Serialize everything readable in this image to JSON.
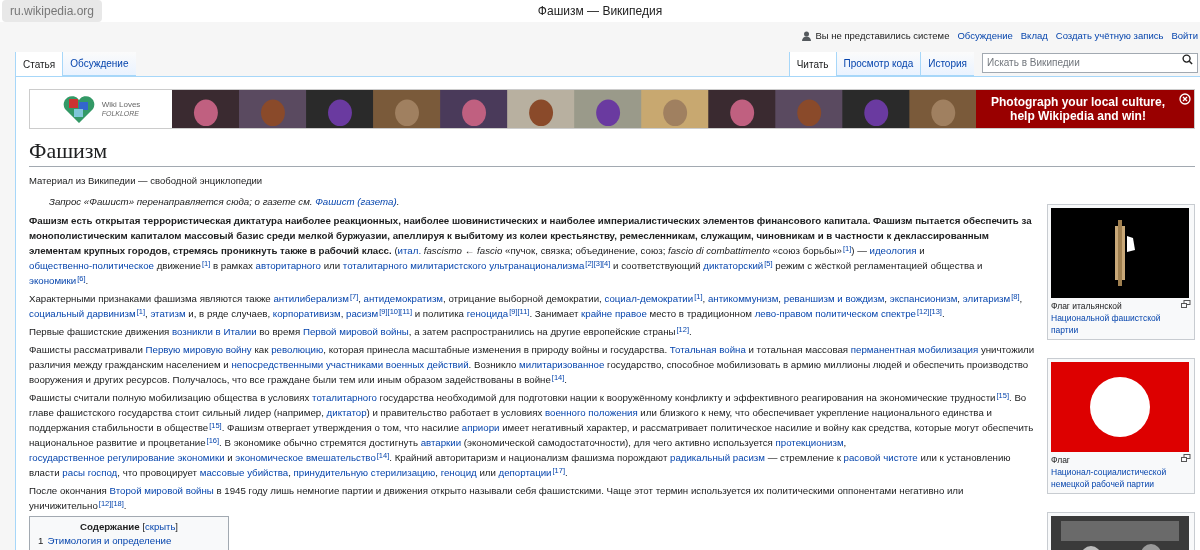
{
  "browser": {
    "address": "ru.wikipedia.org",
    "title": "Фашизм — Википедия"
  },
  "personal_tools": {
    "status": "Вы не представились системе",
    "links": [
      "Обсуждение",
      "Вклад",
      "Создать учётную запись",
      "Войти"
    ]
  },
  "left_tabs": [
    {
      "label": "Статья",
      "selected": true
    },
    {
      "label": "Обсуждение",
      "selected": false
    }
  ],
  "right_tabs": [
    {
      "label": "Читать",
      "selected": true
    },
    {
      "label": "Просмотр кода",
      "selected": false
    },
    {
      "label": "История",
      "selected": false
    }
  ],
  "search": {
    "placeholder": "Искать в Википедии"
  },
  "banner": {
    "logo_top": "Wiki Loves",
    "logo_bottom": "FOLKLORE",
    "message": "Photograph your local culture, help Wikipedia and win!"
  },
  "heading": "Фашизм",
  "tagline": "Материал из Википедии — свободной энциклопедии",
  "hatnote": [
    {
      "kind": "text",
      "text": "Запрос «Фашист» перенаправляется сюда; о газете см. "
    },
    {
      "kind": "link",
      "text": "Фашист (газета)"
    },
    {
      "kind": "text",
      "text": "."
    }
  ],
  "paragraphs": [
    [
      {
        "kind": "bold",
        "text": "Фашизм есть открытая террористическая диктатура наиболее реакционных, наиболее шовинистических и наиболее империалистических элементов финансового капитала. Фашизм пытается обеспечить за монополистическим капиталом массовый базис среди мелкой буржуазии, апеллируя к выбитому из колеи крестьянству, ремесленникам, служащим, чиновникам и в частности к деклассированным элементам крупных городов, стремясь проникнуть также в рабочий класс."
      },
      {
        "kind": "text",
        "text": " ("
      },
      {
        "kind": "link",
        "text": "итал."
      },
      {
        "kind": "italic",
        "text": " fascismo"
      },
      {
        "kind": "text",
        "text": " ← "
      },
      {
        "kind": "italic",
        "text": "fascio"
      },
      {
        "kind": "text",
        "text": " «пучок, связка; объединение, союз; "
      },
      {
        "kind": "italic",
        "text": "fascio di combattimento"
      },
      {
        "kind": "text",
        "text": " «союз борьбы»"
      },
      {
        "kind": "ref",
        "text": "[1]"
      },
      {
        "kind": "text",
        "text": ") — "
      },
      {
        "kind": "link",
        "text": "идеология"
      },
      {
        "kind": "text",
        "text": " и "
      },
      {
        "kind": "link",
        "text": "общественно-политическое"
      },
      {
        "kind": "text",
        "text": " движение"
      },
      {
        "kind": "ref",
        "text": "[1]"
      },
      {
        "kind": "text",
        "text": " в рамках "
      },
      {
        "kind": "link",
        "text": "авторитарного"
      },
      {
        "kind": "text",
        "text": " или "
      },
      {
        "kind": "link",
        "text": "тоталитарного милитаристского ультранационализма"
      },
      {
        "kind": "ref",
        "text": "[2][3][4]"
      },
      {
        "kind": "text",
        "text": " и соответствующий "
      },
      {
        "kind": "link",
        "text": "диктаторский"
      },
      {
        "kind": "ref",
        "text": "[5]"
      },
      {
        "kind": "text",
        "text": " режим с жёсткой регламентацией общества и "
      },
      {
        "kind": "link",
        "text": "экономики"
      },
      {
        "kind": "ref",
        "text": "[6]"
      },
      {
        "kind": "text",
        "text": "."
      }
    ],
    [
      {
        "kind": "text",
        "text": "Характерными признаками фашизма являются также "
      },
      {
        "kind": "link",
        "text": "антилиберализм"
      },
      {
        "kind": "ref",
        "text": "[7]"
      },
      {
        "kind": "text",
        "text": ", "
      },
      {
        "kind": "link",
        "text": "антидемократизм"
      },
      {
        "kind": "text",
        "text": ", отрицание выборной демократии, "
      },
      {
        "kind": "link",
        "text": "социал-демократии"
      },
      {
        "kind": "ref",
        "text": "[1]"
      },
      {
        "kind": "text",
        "text": ", "
      },
      {
        "kind": "link",
        "text": "антикоммунизм"
      },
      {
        "kind": "text",
        "text": ", "
      },
      {
        "kind": "link",
        "text": "реваншизм и вождизм"
      },
      {
        "kind": "text",
        "text": ", "
      },
      {
        "kind": "link",
        "text": "экспансионизм"
      },
      {
        "kind": "text",
        "text": ", "
      },
      {
        "kind": "link",
        "text": "элитаризм"
      },
      {
        "kind": "ref",
        "text": "[8]"
      },
      {
        "kind": "text",
        "text": ", "
      },
      {
        "kind": "link",
        "text": "социальный дарвинизм"
      },
      {
        "kind": "ref",
        "text": "[1]"
      },
      {
        "kind": "text",
        "text": ", "
      },
      {
        "kind": "link",
        "text": "этатизм"
      },
      {
        "kind": "text",
        "text": " и, в ряде случаев, "
      },
      {
        "kind": "link",
        "text": "корпоративизм"
      },
      {
        "kind": "text",
        "text": ", "
      },
      {
        "kind": "link",
        "text": "расизм"
      },
      {
        "kind": "ref",
        "text": "[9][10][11]"
      },
      {
        "kind": "text",
        "text": " и политика "
      },
      {
        "kind": "link",
        "text": "геноцида"
      },
      {
        "kind": "ref",
        "text": "[9][11]"
      },
      {
        "kind": "text",
        "text": ". Занимает "
      },
      {
        "kind": "link",
        "text": "крайне правое"
      },
      {
        "kind": "text",
        "text": " место в традиционном "
      },
      {
        "kind": "link",
        "text": "лево-правом политическом спектре"
      },
      {
        "kind": "ref",
        "text": "[12][13]"
      },
      {
        "kind": "text",
        "text": "."
      }
    ],
    [
      {
        "kind": "text",
        "text": "Первые фашистские движения "
      },
      {
        "kind": "link",
        "text": "возникли в Италии"
      },
      {
        "kind": "text",
        "text": " во время "
      },
      {
        "kind": "link",
        "text": "Первой мировой войны"
      },
      {
        "kind": "text",
        "text": ", а затем распространились на другие европейские страны"
      },
      {
        "kind": "ref",
        "text": "[12]"
      },
      {
        "kind": "text",
        "text": "."
      }
    ],
    [
      {
        "kind": "text",
        "text": "Фашисты рассматривали "
      },
      {
        "kind": "link",
        "text": "Первую мировую войну"
      },
      {
        "kind": "text",
        "text": " как "
      },
      {
        "kind": "link",
        "text": "революцию"
      },
      {
        "kind": "text",
        "text": ", которая принесла масштабные изменения в природу войны и государства. "
      },
      {
        "kind": "link",
        "text": "Тотальная война"
      },
      {
        "kind": "text",
        "text": " и тотальная массовая "
      },
      {
        "kind": "link",
        "text": "перманентная мобилизация"
      },
      {
        "kind": "text",
        "text": " уничтожили различия между гражданским населением и "
      },
      {
        "kind": "link",
        "text": "непосредственными участниками военных действий"
      },
      {
        "kind": "text",
        "text": ". Возникло "
      },
      {
        "kind": "link",
        "text": "милитаризованное"
      },
      {
        "kind": "text",
        "text": " государство, способное мобилизовать в армию миллионы людей и обеспечить производство вооружения и других ресурсов. Получалось, что все граждане были тем или иным образом задействованы в войне"
      },
      {
        "kind": "ref",
        "text": "[14]"
      },
      {
        "kind": "text",
        "text": "."
      }
    ],
    [
      {
        "kind": "text",
        "text": "Фашисты считали полную мобилизацию общества в условиях "
      },
      {
        "kind": "link",
        "text": "тоталитарного"
      },
      {
        "kind": "text",
        "text": " государства необходимой для подготовки нации к вооружённому конфликту и эффективного реагирования на экономические трудности"
      },
      {
        "kind": "ref",
        "text": "[15]"
      },
      {
        "kind": "text",
        "text": ". Во главе фашистского государства стоит сильный лидер (например, "
      },
      {
        "kind": "link",
        "text": "диктатор"
      },
      {
        "kind": "text",
        "text": ") и правительство работает в условиях "
      },
      {
        "kind": "link",
        "text": "военного положения"
      },
      {
        "kind": "text",
        "text": " или близкого к нему, что обеспечивает укрепление национального единства и поддержания стабильности в обществе"
      },
      {
        "kind": "ref",
        "text": "[15]"
      },
      {
        "kind": "text",
        "text": ". Фашизм отвергает утверждения о том, что насилие "
      },
      {
        "kind": "link",
        "text": "априори"
      },
      {
        "kind": "text",
        "text": " имеет негативный характер, и рассматривает политическое насилие и войну как средства, которые могут обеспечить национальное развитие и процветание"
      },
      {
        "kind": "ref",
        "text": "[16]"
      },
      {
        "kind": "text",
        "text": ". В экономике обычно стремятся достигнуть "
      },
      {
        "kind": "link",
        "text": "автаркии"
      },
      {
        "kind": "text",
        "text": " (экономической самодостаточности), для чего активно используется "
      },
      {
        "kind": "link",
        "text": "протекционизм"
      },
      {
        "kind": "text",
        "text": ", "
      },
      {
        "kind": "link",
        "text": "государственное регулирование экономики"
      },
      {
        "kind": "text",
        "text": " и "
      },
      {
        "kind": "link",
        "text": "экономическое вмешательство"
      },
      {
        "kind": "ref",
        "text": "[14]"
      },
      {
        "kind": "text",
        "text": ". Крайний авторитаризм и национализм фашизма порождают "
      },
      {
        "kind": "link",
        "text": "радикальный расизм"
      },
      {
        "kind": "text",
        "text": " — стремление к "
      },
      {
        "kind": "link",
        "text": "расовой чистоте"
      },
      {
        "kind": "text",
        "text": " или к установлению власти "
      },
      {
        "kind": "link",
        "text": "расы господ"
      },
      {
        "kind": "text",
        "text": ", что провоцирует "
      },
      {
        "kind": "link",
        "text": "массовые убийства"
      },
      {
        "kind": "text",
        "text": ", "
      },
      {
        "kind": "link",
        "text": "принудительную стерилизацию"
      },
      {
        "kind": "text",
        "text": ", "
      },
      {
        "kind": "link",
        "text": "геноцид"
      },
      {
        "kind": "text",
        "text": " или "
      },
      {
        "kind": "link",
        "text": "депортации"
      },
      {
        "kind": "ref",
        "text": "[17]"
      },
      {
        "kind": "text",
        "text": "."
      }
    ],
    [
      {
        "kind": "text",
        "text": "После окончания "
      },
      {
        "kind": "link",
        "text": "Второй мировой войны"
      },
      {
        "kind": "text",
        "text": " в 1945 году лишь немногие партии и движения открыто называли себя фашистскими. Чаще этот термин используется их политическими оппонентами негативно или уничижительно"
      },
      {
        "kind": "ref",
        "text": "[12][18]"
      },
      {
        "kind": "text",
        "text": "."
      }
    ]
  ],
  "toc": {
    "title": "Содержание",
    "toggle_open": "[",
    "toggle": "скрыть",
    "toggle_close": "]",
    "items": [
      {
        "number": "1",
        "label": "Этимология и определение"
      }
    ]
  },
  "thumbs": [
    {
      "kind": "picture",
      "caption": [
        {
          "kind": "text",
          "text": "Флаг итальянской "
        },
        {
          "kind": "link",
          "text": "Национальной фашистской партии"
        }
      ]
    },
    {
      "kind": "picture",
      "caption": [
        {
          "kind": "text",
          "text": "Флаг "
        },
        {
          "kind": "link",
          "text": "Национал-социалистической немецкой рабочей партии"
        }
      ]
    },
    {
      "kind": "picture"
    }
  ]
}
